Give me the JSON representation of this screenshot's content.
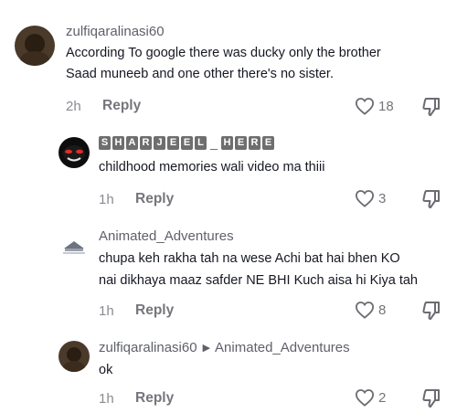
{
  "comments": [
    {
      "username": "zulfiqaralinasi60",
      "lines": [
        "According To google there was ducky only the brother",
        "Saad muneeb and one other there's no sister."
      ],
      "time": "2h",
      "reply_label": "Reply",
      "likes": "18"
    },
    {
      "username": "SHARJEEL_HERE",
      "username_chars": [
        "S",
        "H",
        "A",
        "R",
        "J",
        "E",
        "E",
        "L",
        "_",
        "H",
        "E",
        "R",
        "E"
      ],
      "lines": [
        "childhood memories wali video ma thiii"
      ],
      "time": "1h",
      "reply_label": "Reply",
      "likes": "3"
    },
    {
      "username": "Animated_Adventures",
      "lines": [
        "chupa keh rakha tah na wese Achi bat hai bhen KO",
        "nai dikhaya maaz safder NE BHI Kuch aisa hi Kiya tah"
      ],
      "time": "1h",
      "reply_label": "Reply",
      "likes": "8"
    },
    {
      "username": "zulfiqaralinasi60",
      "reply_to": "Animated_Adventures",
      "lines": [
        "ok"
      ],
      "time": "1h",
      "reply_label": "Reply",
      "likes": "2"
    }
  ],
  "icons": {
    "like": "heart-outline-icon",
    "dislike": "thumbs-down-icon",
    "reply_arrow": "triangle-right-icon"
  }
}
